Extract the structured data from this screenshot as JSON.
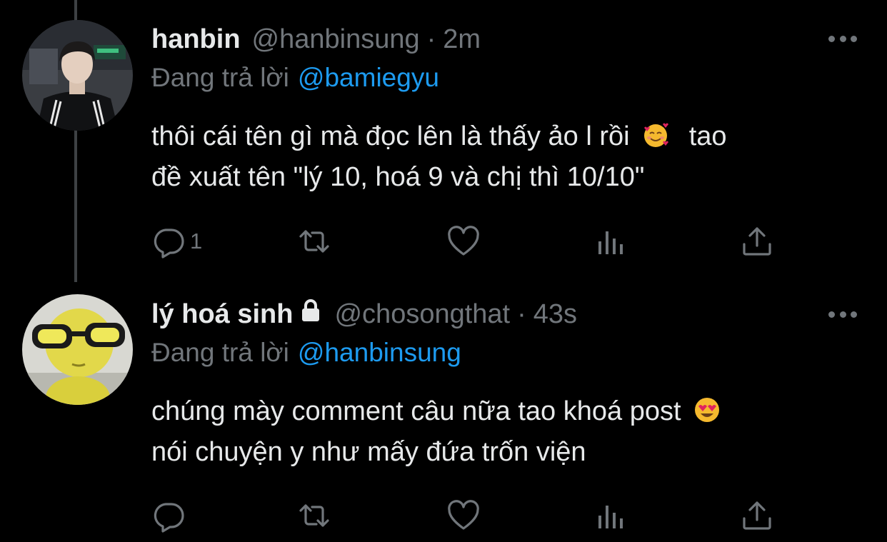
{
  "colors": {
    "background": "#000000",
    "text_primary": "#e7e9ea",
    "text_secondary": "#71767b",
    "accent": "#1d9bf0",
    "thread_line": "#3e4144"
  },
  "tweets": [
    {
      "display_name": "hanbin",
      "handle": "@hanbinsung",
      "separator": "·",
      "time": "2m",
      "replying_label": "Đang trả lời",
      "replying_to": "@bamiegyu",
      "text_line1": "thôi cái tên gì mà đọc lên là thấy ảo l rồi",
      "text_line1_emoji": "smiling-face-with-hearts",
      "text_line1_after": "tao",
      "text_line2": "đề xuất tên \"lý 10, hoá 9 và chị thì 10/10\"",
      "reply_count": "1",
      "icons": [
        "reply-icon",
        "retweet-icon",
        "like-icon",
        "views-icon",
        "share-icon",
        "more-icon"
      ]
    },
    {
      "display_name": "lý hoá sinh",
      "locked": true,
      "handle": "@chosongthat",
      "separator": "·",
      "time": "43s",
      "replying_label": "Đang trả lời",
      "replying_to": "@hanbinsung",
      "text_line1": "chúng mày comment câu nữa tao khoá post",
      "text_line1_emoji": "heart-eyes",
      "text_line2": "nói chuyện y như mấy đứa trốn viện",
      "icons": [
        "reply-icon",
        "retweet-icon",
        "like-icon",
        "views-icon",
        "share-icon",
        "more-icon"
      ]
    }
  ]
}
